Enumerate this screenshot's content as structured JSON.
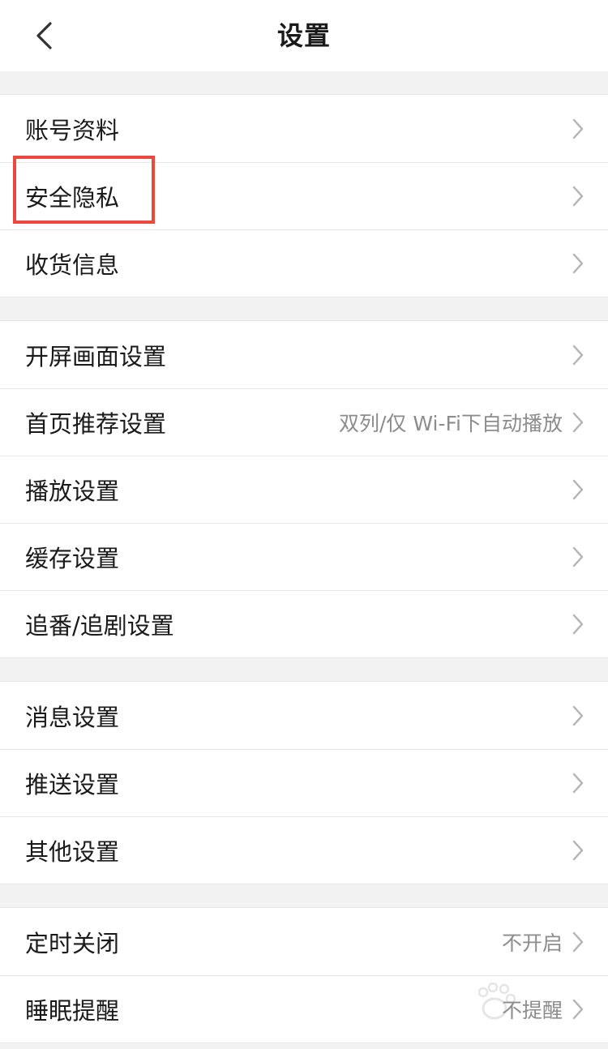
{
  "header": {
    "title": "设置",
    "back_icon": "chevron-left-icon"
  },
  "groups": [
    {
      "items": [
        {
          "label": "账号资料",
          "value": ""
        },
        {
          "label": "安全隐私",
          "value": ""
        },
        {
          "label": "收货信息",
          "value": ""
        }
      ]
    },
    {
      "items": [
        {
          "label": "开屏画面设置",
          "value": ""
        },
        {
          "label": "首页推荐设置",
          "value": "双列/仅 Wi-Fi下自动播放"
        },
        {
          "label": "播放设置",
          "value": ""
        },
        {
          "label": "缓存设置",
          "value": ""
        },
        {
          "label": "追番/追剧设置",
          "value": ""
        }
      ]
    },
    {
      "items": [
        {
          "label": "消息设置",
          "value": ""
        },
        {
          "label": "推送设置",
          "value": ""
        },
        {
          "label": "其他设置",
          "value": ""
        }
      ]
    },
    {
      "items": [
        {
          "label": "定时关闭",
          "value": "不开启"
        },
        {
          "label": "睡眠提醒",
          "value": "不提醒"
        }
      ]
    }
  ],
  "colors": {
    "highlight": "#e84a3f",
    "background": "#f2f2f2",
    "secondary_text": "#8c8c8c"
  }
}
